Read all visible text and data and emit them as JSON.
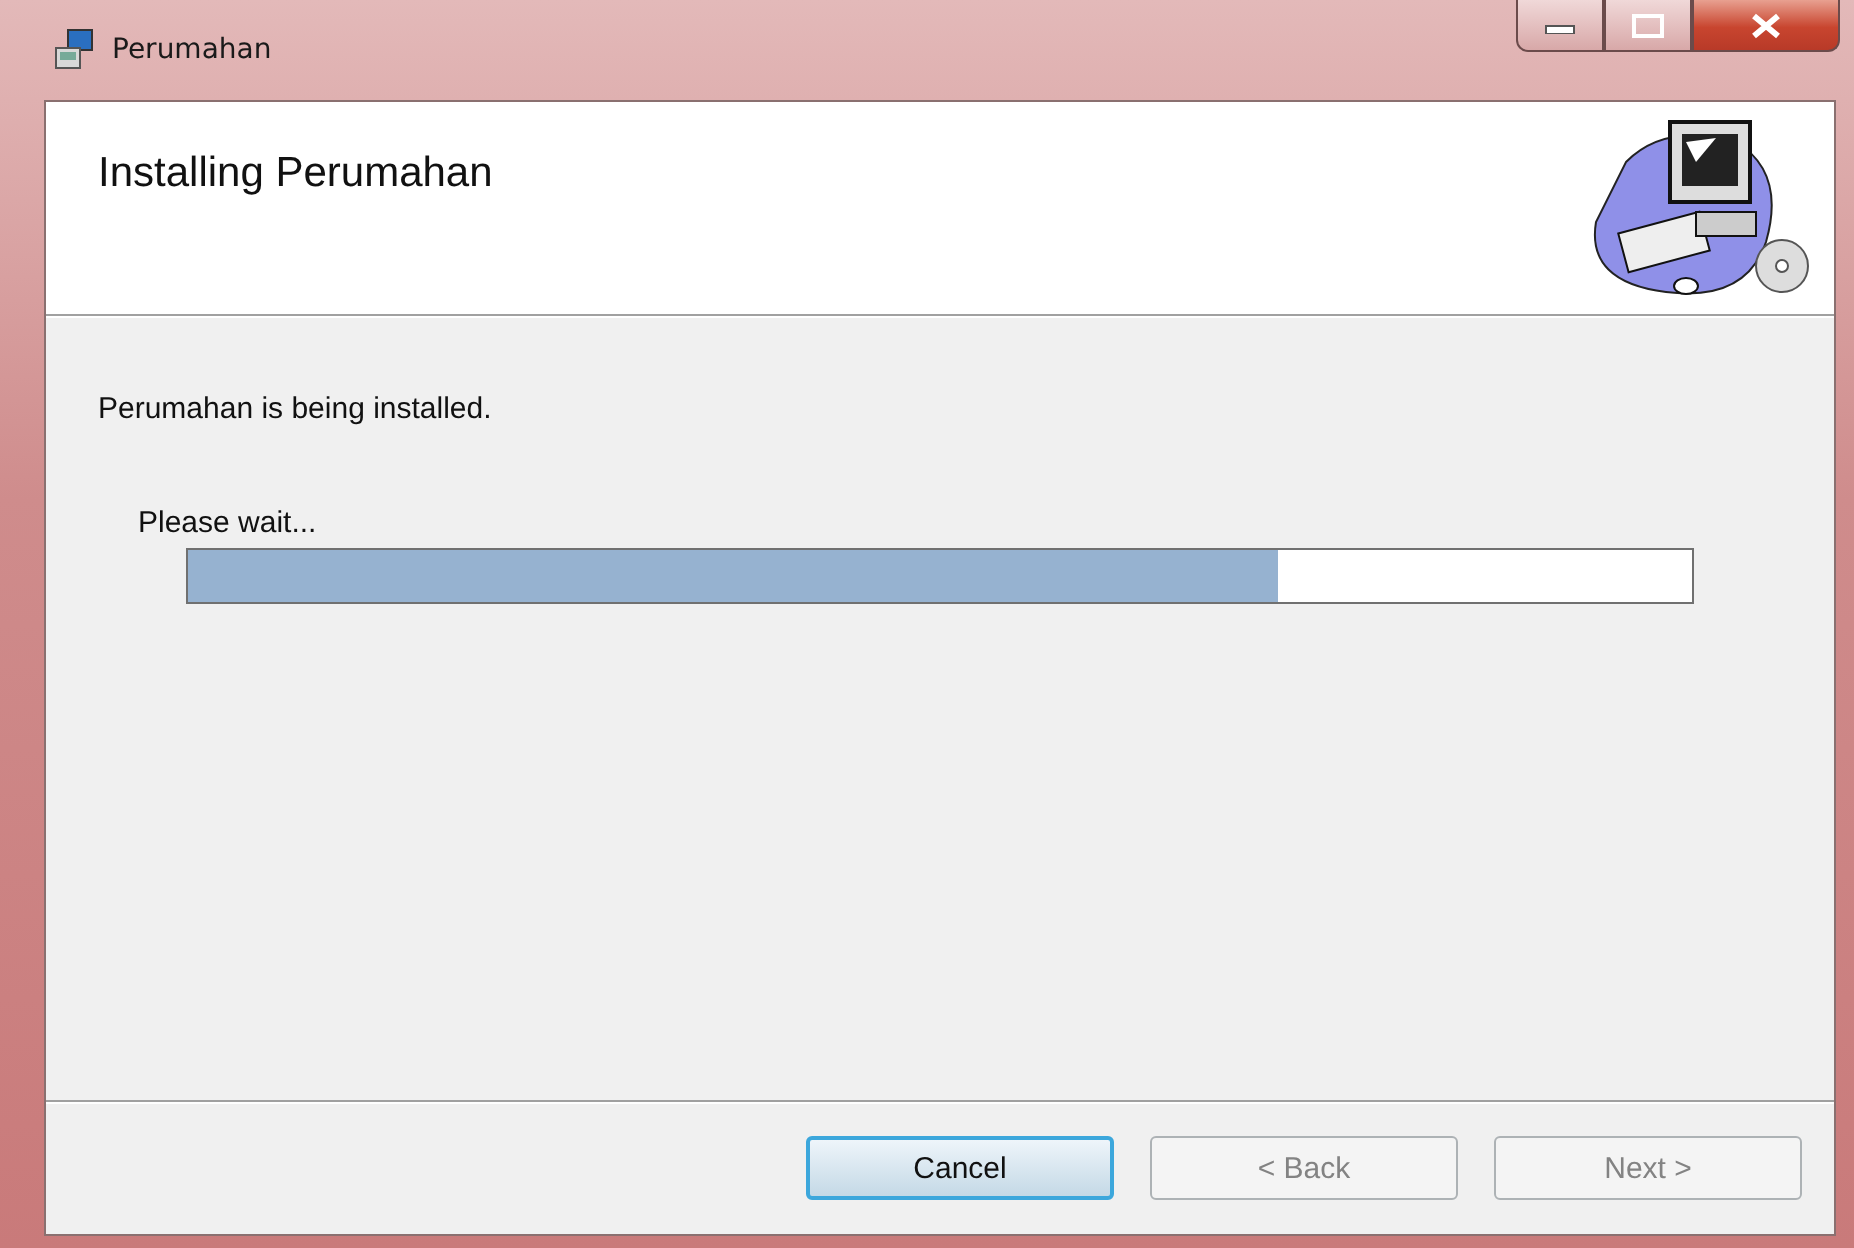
{
  "window": {
    "title": "Perumahan"
  },
  "header": {
    "title": "Installing Perumahan"
  },
  "status_text": "Perumahan is being installed.",
  "progress": {
    "label": "Please wait...",
    "level": 0.725
  },
  "buttons": [
    {
      "label": "Cancel",
      "disabled": false,
      "default": true
    },
    {
      "label": "< Back",
      "disabled": true,
      "default": false
    },
    {
      "label": "Next >",
      "disabled": true,
      "default": false
    }
  ]
}
